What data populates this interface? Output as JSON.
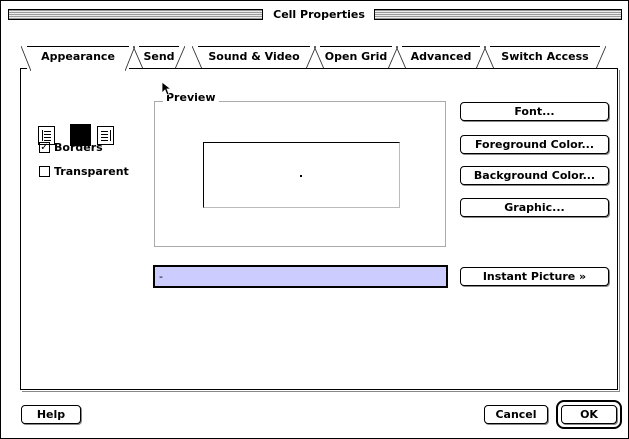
{
  "window": {
    "title": "Cell Properties"
  },
  "tabs": [
    {
      "label": "Appearance",
      "active": true
    },
    {
      "label": "Send",
      "active": false
    },
    {
      "label": "Sound & Video",
      "active": false
    },
    {
      "label": "Open Grid",
      "active": false
    },
    {
      "label": "Advanced",
      "active": false
    },
    {
      "label": "Switch Access",
      "active": false
    }
  ],
  "appearance": {
    "alignment": {
      "options": [
        "left",
        "center",
        "right"
      ],
      "selected": "center"
    },
    "checkboxes": {
      "borders": {
        "label": "Borders",
        "checked": true
      },
      "transparent": {
        "label": "Transparent",
        "checked": false
      }
    },
    "preview": {
      "label": "Preview"
    },
    "name_input": {
      "value": "-"
    },
    "buttons": {
      "font": "Font...",
      "foreground_color": "Foreground Color...",
      "background_color": "Background Color...",
      "graphic": "Graphic...",
      "instant_picture": "Instant Picture »"
    }
  },
  "footer": {
    "help": "Help",
    "cancel": "Cancel",
    "ok": "OK"
  },
  "colors": {
    "input_background": "#ccccff",
    "selected_alignment": "#000000"
  }
}
